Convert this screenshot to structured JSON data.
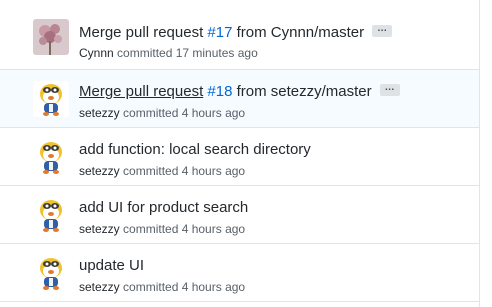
{
  "commits": [
    {
      "message": "Merge pull request ",
      "pr_number": "#17",
      "suffix": " from Cynnn/master",
      "author": "Cynnn",
      "action": " committed ",
      "time": "17 minutes ago",
      "avatar": "flower-photo",
      "highlighted": false
    },
    {
      "message": "Merge pull request",
      "pr_number": "#18",
      "suffix": " from setezzy/master",
      "author": "setezzy",
      "action": " committed ",
      "time": "4 hours ago",
      "avatar": "cartoon-penguin",
      "highlighted": true
    },
    {
      "message": "add function: local search directory",
      "author": "setezzy",
      "action": " committed ",
      "time": "4 hours ago",
      "avatar": "cartoon-penguin"
    },
    {
      "message": "add UI for product search",
      "author": "setezzy",
      "action": " committed ",
      "time": "4 hours ago",
      "avatar": "cartoon-penguin"
    },
    {
      "message": "update UI",
      "author": "setezzy",
      "action": " committed ",
      "time": "4 hours ago",
      "avatar": "cartoon-penguin"
    }
  ],
  "ellipsis_label": "…",
  "colors": {
    "link": "#0366d6",
    "text": "#24292e",
    "muted": "#586069",
    "highlight_bg": "#f6fbff"
  }
}
